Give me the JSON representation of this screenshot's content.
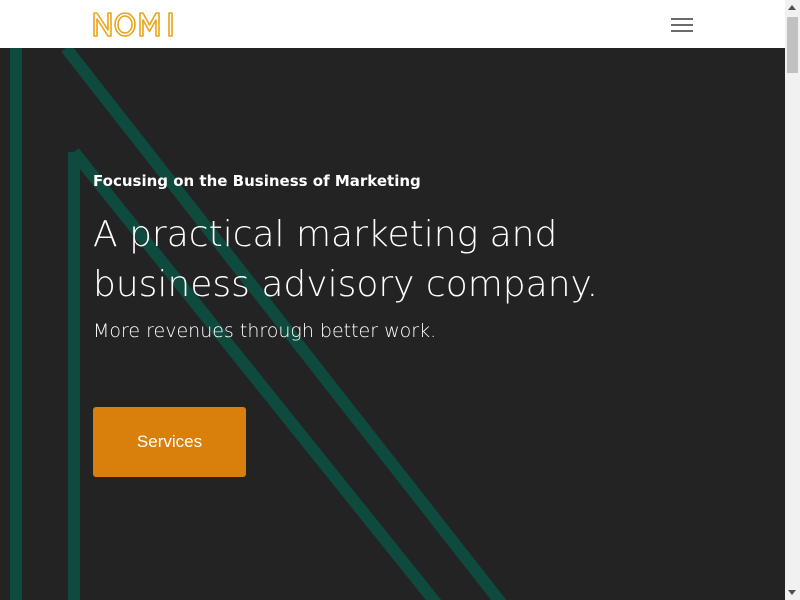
{
  "brand": {
    "logo_text": "NOMI",
    "logo_color": "#e8a517"
  },
  "header": {
    "menu_icon": "hamburger-menu-icon"
  },
  "hero": {
    "eyebrow": "Focusing on the Business of Marketing",
    "headline_line1": "A practical marketing and",
    "headline_line2": "business advisory company.",
    "subhead": "More revenues through better work.",
    "cta_label": "Services"
  },
  "colors": {
    "background": "#232323",
    "accent_lines": "#0f4a3e",
    "cta": "#d9800c",
    "text": "#ffffff"
  }
}
